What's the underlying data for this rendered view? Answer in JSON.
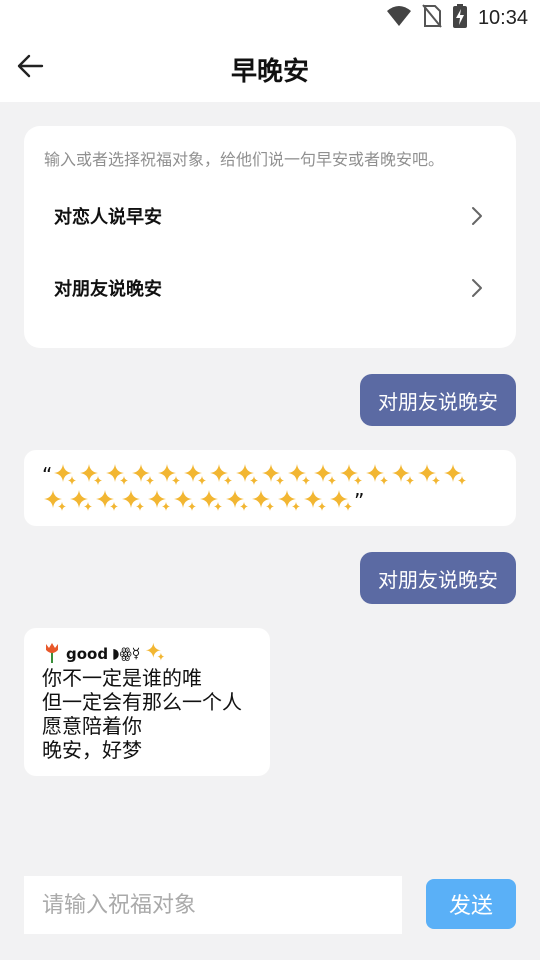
{
  "status_bar": {
    "time": "10:34",
    "icons": [
      "wifi-icon",
      "no-sim-icon",
      "battery-charging-icon"
    ]
  },
  "header": {
    "title": "早晚安",
    "back_icon": "arrow-left-icon"
  },
  "card": {
    "hint": "输入或者选择祝福对象，给他们说一句早安或者晚安吧。",
    "options": [
      {
        "label": "对恋人说早安"
      },
      {
        "label": "对朋友说晚安"
      }
    ]
  },
  "messages": {
    "sent_1": "对朋友说晚安",
    "recv_1": {
      "open_quote": "“",
      "close_quote": "”",
      "sparkle_count": 28
    },
    "sent_2": "对朋友说晚安",
    "recv_2": {
      "emoji_tag": "good",
      "symbols": "◗ꙮ☿",
      "lines": [
        "你不一定是谁的唯",
        "但一定会有那么一个人",
        "愿意陪着你",
        "晚安，好梦"
      ]
    }
  },
  "composer": {
    "placeholder": "请输入祝福对象",
    "send_label": "发送"
  },
  "colors": {
    "sent_bubble": "#5b6aa3",
    "send_button": "#5ab0f7",
    "sparkle": "#f2b632"
  }
}
